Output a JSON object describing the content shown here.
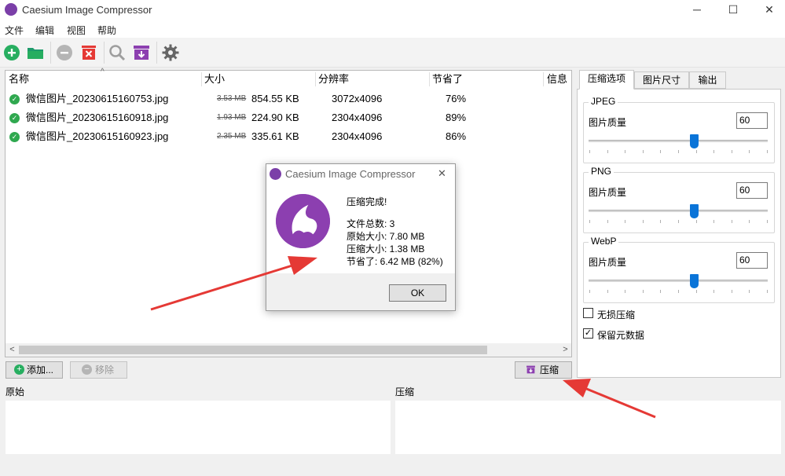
{
  "window": {
    "title": "Caesium Image Compressor"
  },
  "menu": [
    "文件",
    "编辑",
    "视图",
    "帮助"
  ],
  "toolbar": {
    "icons": [
      "add-file-icon",
      "open-folder-icon",
      "remove-icon",
      "clear-list-icon",
      "preview-icon",
      "compress-icon",
      "settings-icon"
    ]
  },
  "file_list": {
    "headers": [
      "名称",
      "大小",
      "分辨率",
      "节省了",
      "信息"
    ],
    "rows": [
      {
        "name": "微信图片_20230615160753.jpg",
        "old_size": "3.53 MB",
        "new_size": "854.55 KB",
        "resolution": "3072x4096",
        "saved": "76%"
      },
      {
        "name": "微信图片_20230615160918.jpg",
        "old_size": "1.93 MB",
        "new_size": "224.90 KB",
        "resolution": "2304x4096",
        "saved": "89%"
      },
      {
        "name": "微信图片_20230615160923.jpg",
        "old_size": "2.35 MB",
        "new_size": "335.61 KB",
        "resolution": "2304x4096",
        "saved": "86%"
      }
    ]
  },
  "buttons": {
    "add": "添加...",
    "remove": "移除",
    "compress": "压缩"
  },
  "preview": {
    "original": "原始",
    "compressed": "压缩"
  },
  "tabs": [
    "压缩选项",
    "图片尺寸",
    "输出"
  ],
  "options": {
    "quality_label": "图片质量",
    "groups": [
      {
        "title": "JPEG",
        "value": "60"
      },
      {
        "title": "PNG",
        "value": "60"
      },
      {
        "title": "WebP",
        "value": "60"
      }
    ],
    "quality_fraction": 0.6,
    "lossless": {
      "label": "无损压缩",
      "checked": false
    },
    "keep_metadata": {
      "label": "保留元数据",
      "checked": true
    }
  },
  "dialog": {
    "title": "Caesium Image Compressor",
    "heading": "压缩完成!",
    "total": "文件总数: 3",
    "original": "原始大小: 7.80 MB",
    "compressed": "压缩大小: 1.38 MB",
    "saved": "节省了: 6.42 MB (82%)",
    "ok": "OK"
  },
  "colors": {
    "accent": "#8c3fb0",
    "annotation": "#e53935",
    "check": "#2fa84f",
    "slider": "#0a74d8"
  }
}
